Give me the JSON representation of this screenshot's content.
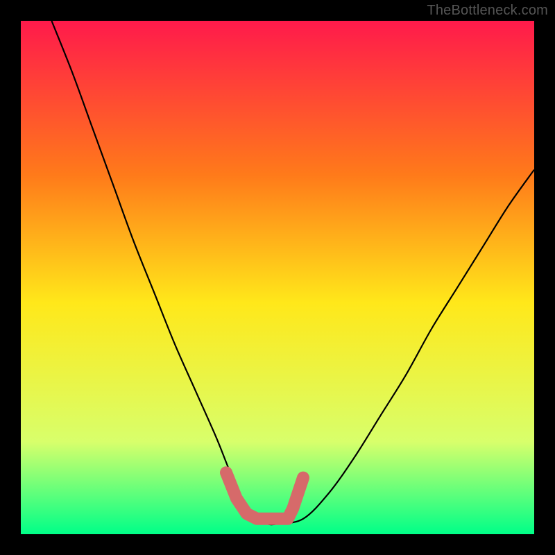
{
  "watermark": "TheBottleneck.com",
  "chart_data": {
    "type": "line",
    "title": "",
    "xlabel": "",
    "ylabel": "",
    "xlim": [
      0,
      100
    ],
    "ylim": [
      0,
      100
    ],
    "background_gradient": {
      "top": "#ff1a4b",
      "upper_mid": "#ff7a1a",
      "mid": "#ffe81a",
      "lower_mid": "#d8ff6b",
      "bottom": "#00ff88"
    },
    "series": [
      {
        "name": "bottleneck-curve",
        "color": "#000000",
        "x": [
          6,
          10,
          14,
          18,
          22,
          26,
          30,
          34,
          38,
          40,
          42,
          44,
          46,
          48,
          50,
          55,
          60,
          65,
          70,
          75,
          80,
          85,
          90,
          95,
          100
        ],
        "y": [
          100,
          90,
          79,
          68,
          57,
          47,
          37,
          28,
          19,
          14,
          9,
          5,
          3,
          2,
          2,
          3,
          8,
          15,
          23,
          31,
          40,
          48,
          56,
          64,
          71
        ]
      }
    ],
    "marker_segment": {
      "name": "optimal-range-marker",
      "color": "#d66a6a",
      "points": [
        {
          "x": 40,
          "y": 12
        },
        {
          "x": 42,
          "y": 7
        },
        {
          "x": 44,
          "y": 4
        },
        {
          "x": 46,
          "y": 3
        },
        {
          "x": 48,
          "y": 3
        },
        {
          "x": 50,
          "y": 3
        },
        {
          "x": 52,
          "y": 3
        },
        {
          "x": 53,
          "y": 5
        },
        {
          "x": 54,
          "y": 8
        },
        {
          "x": 55,
          "y": 11
        }
      ]
    }
  }
}
